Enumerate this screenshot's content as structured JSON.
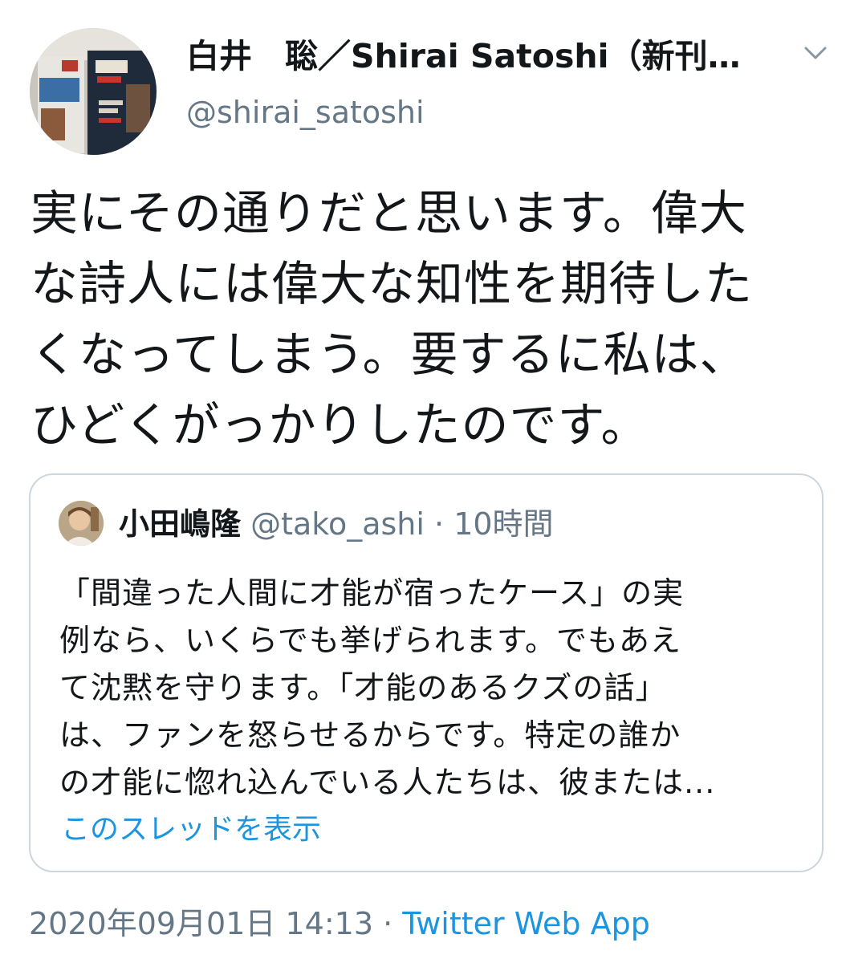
{
  "author": {
    "display_name": "白井　聡／Shirai Satoshi（新刊『...",
    "handle": "@shirai_satoshi",
    "avatar_icon": "book-cover-avatar-icon"
  },
  "menu_icon": "chevron-down-icon",
  "tweet": {
    "lines": [
      "実にその通りだと思います。偉大",
      "な詩人には偉大な知性を期待した",
      "くなってしまう。要するに私は、",
      "ひどくがっかりしたのです。"
    ]
  },
  "quoted": {
    "name": "小田嶋隆",
    "handle": "@tako_ashi",
    "separator": " · ",
    "time": "10時間",
    "lines": [
      "「間違った人間に才能が宿ったケース」の実",
      "例なら、いくらでも挙げられます。でもあえ",
      "て沈黙を守ります。「才能のあるクズの話」",
      "は、ファンを怒らせるからです。特定の誰か",
      "の才能に惚れ込んでいる人たちは、彼または..."
    ],
    "show_thread": "このスレッドを表示"
  },
  "footer": {
    "timestamp": "2020年09月01日 14:13",
    "separator": " · ",
    "source": "Twitter Web App"
  },
  "colors": {
    "text": "#14171a",
    "secondary": "#657786",
    "link": "#1b95e0",
    "border": "#ccd6dd"
  }
}
